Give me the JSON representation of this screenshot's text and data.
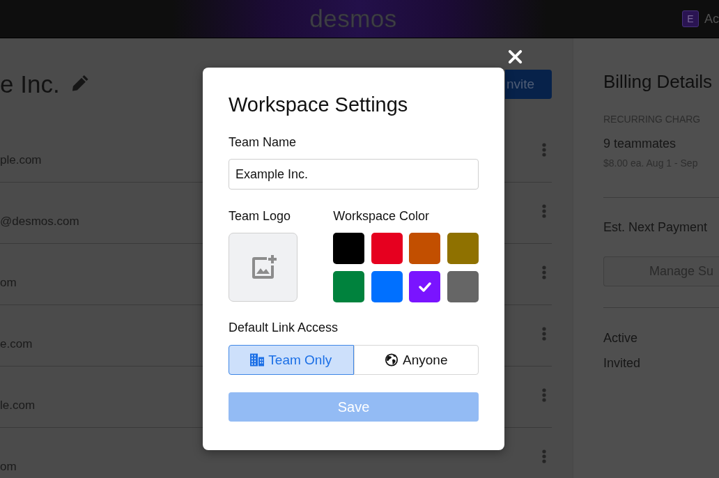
{
  "top_bar": {
    "logo": "desmos",
    "account": {
      "initial": "E",
      "label": "Ac"
    }
  },
  "team": {
    "name": "e Inc.",
    "invite_button": "nvite",
    "members": [
      {
        "email": "ple.com"
      },
      {
        "email": "@desmos.com"
      },
      {
        "email": "om"
      },
      {
        "email": "e.com"
      },
      {
        "email": "le.com"
      },
      {
        "email": "om"
      }
    ]
  },
  "billing": {
    "title": "Billing Details",
    "recurring_label": "RECURRING CHARG",
    "teammates": "9 teammates",
    "rate": "$8.00 ea. Aug 1 - Sep",
    "next_payment_label": "Est. Next Payment",
    "manage_button": "Manage Su",
    "statuses": [
      "Active",
      "Invited"
    ]
  },
  "dialog": {
    "title": "Workspace Settings",
    "team_name": {
      "label": "Team Name",
      "value": "Example Inc."
    },
    "team_logo": {
      "label": "Team Logo"
    },
    "workspace_color": {
      "label": "Workspace Color",
      "swatches": [
        {
          "color": "#000000",
          "selected": false
        },
        {
          "color": "#e6001f",
          "selected": false
        },
        {
          "color": "#c24f00",
          "selected": false
        },
        {
          "color": "#8f7100",
          "selected": false
        },
        {
          "color": "#00823d",
          "selected": false
        },
        {
          "color": "#0070ff",
          "selected": false
        },
        {
          "color": "#7a14ff",
          "selected": true
        },
        {
          "color": "#666666",
          "selected": false
        }
      ]
    },
    "link_access": {
      "label": "Default Link Access",
      "options": [
        {
          "kind": "team",
          "label": "Team Only",
          "selected": true
        },
        {
          "kind": "public",
          "label": "Anyone",
          "selected": false
        }
      ]
    },
    "save_button": {
      "label": "Save",
      "disabled": true
    }
  }
}
